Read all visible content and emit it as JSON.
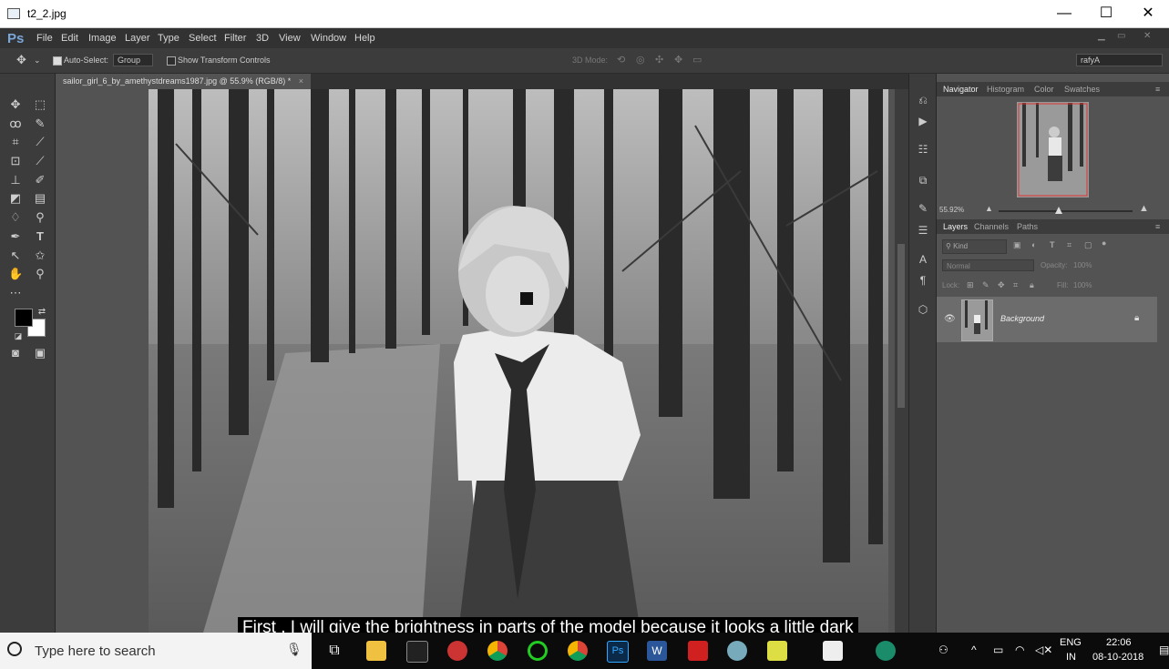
{
  "window": {
    "title": "t2_2.jpg",
    "minimize": "—",
    "maximize": "☐",
    "close": "✕"
  },
  "app": {
    "logo": "Ps"
  },
  "menu": [
    "File",
    "Edit",
    "Image",
    "Layer",
    "Type",
    "Select",
    "Filter",
    "3D",
    "View",
    "Window",
    "Help"
  ],
  "options": {
    "auto_select_label": "Auto-Select:",
    "auto_select_value": "Group",
    "show_transform": "Show Transform Controls",
    "mode_3d": "3D Mode:",
    "workspace": "rafyA"
  },
  "document": {
    "tab_label": "sailor_girl_6_by_amethystdreams1987.jpg @ 55.9% (RGB/8) *"
  },
  "navigator": {
    "tabs": [
      "Navigator",
      "Histogram",
      "Color",
      "Swatches"
    ],
    "zoom": "55.92%",
    "zoom_slider_fraction": 0.45
  },
  "layers": {
    "tabs": [
      "Layers",
      "Channels",
      "Paths"
    ],
    "filter_kind": "Kind",
    "blend_mode": "Normal",
    "opacity_label": "Opacity:",
    "opacity_value": "100%",
    "lock_label": "Lock:",
    "fill_label": "Fill:",
    "fill_value": "100%",
    "items": [
      {
        "name": "Background",
        "locked": true,
        "visible": true
      }
    ]
  },
  "subtitle": "First , I will give the brightness in parts of the model because it looks a little dark",
  "taskbar": {
    "search_placeholder": "Type here to search",
    "lang": "ENG",
    "region": "IN",
    "time": "22:06",
    "date": "08-10-2018"
  }
}
